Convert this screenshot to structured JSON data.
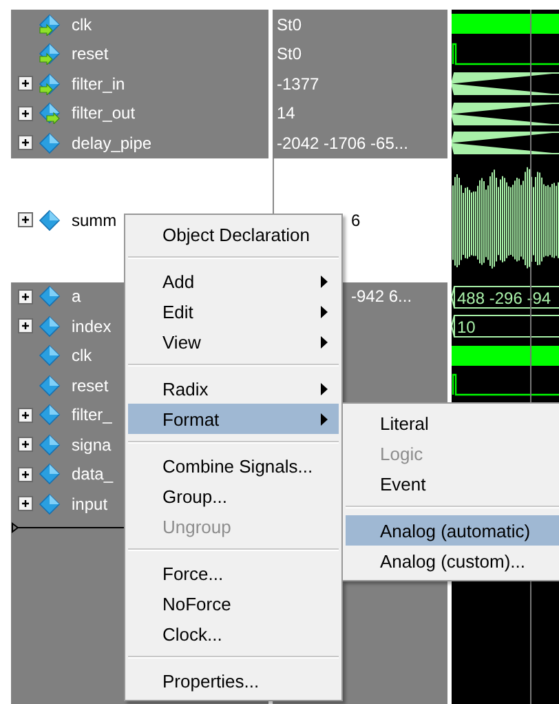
{
  "signals": [
    {
      "name": "clk",
      "value": "St0",
      "icon": {
        "kind": "in"
      },
      "selected": true,
      "wave": {
        "kind": "clock"
      }
    },
    {
      "name": "reset",
      "value": "St0",
      "icon": {
        "kind": "in"
      },
      "selected": true,
      "wave": {
        "kind": "bit"
      }
    },
    {
      "name": "filter_in",
      "value": "-1377",
      "icon": {
        "kind": "in"
      },
      "expanded": false,
      "selected": true,
      "wave": {
        "kind": "bus"
      }
    },
    {
      "name": "filter_out",
      "value": "14",
      "icon": {
        "kind": "out"
      },
      "expanded": false,
      "selected": true,
      "wave": {
        "kind": "bus"
      }
    },
    {
      "name": "delay_pipe",
      "value": "-2042 -1706 -65...",
      "icon": {
        "kind": "internal"
      },
      "expanded": false,
      "selected": true,
      "wave": {
        "kind": "bus"
      }
    },
    {
      "name": "summ",
      "value": "6",
      "icon": {
        "kind": "internal"
      },
      "expanded": false,
      "selected": false,
      "wave": {
        "kind": "analog"
      }
    },
    {
      "name": "a",
      "value": "-942 6...",
      "icon": {
        "kind": "internal"
      },
      "expanded": false,
      "selected": true,
      "wave": {
        "kind": "bus",
        "label": "488 -296 -94"
      }
    },
    {
      "name": "index",
      "icon": {
        "kind": "internal"
      },
      "expanded": false,
      "selected": true,
      "wave": {
        "kind": "bus",
        "label": "10"
      }
    },
    {
      "name": "clk",
      "icon": {
        "kind": "internal"
      },
      "selected": true,
      "wave": {
        "kind": "clock"
      }
    },
    {
      "name": "reset",
      "icon": {
        "kind": "internal"
      },
      "selected": true,
      "wave": {
        "kind": "bit"
      }
    },
    {
      "name": "filter_",
      "icon": {
        "kind": "internal"
      },
      "expanded": false,
      "selected": true
    },
    {
      "name": "signa",
      "icon": {
        "kind": "internal"
      },
      "expanded": false,
      "selected": true
    },
    {
      "name": "data_",
      "icon": {
        "kind": "internal"
      },
      "expanded": false,
      "selected": true
    },
    {
      "name": "input",
      "icon": {
        "kind": "internal"
      },
      "expanded": false,
      "selected": true
    }
  ],
  "context_menu": {
    "items": [
      {
        "kind": "item",
        "label": "Object Declaration",
        "has_submenu": false,
        "disabled": false,
        "selected": false
      },
      {
        "kind": "separator"
      },
      {
        "kind": "item",
        "label": "Add",
        "has_submenu": true,
        "disabled": false,
        "selected": false
      },
      {
        "kind": "item",
        "label": "Edit",
        "has_submenu": true,
        "disabled": false,
        "selected": false
      },
      {
        "kind": "item",
        "label": "View",
        "has_submenu": true,
        "disabled": false,
        "selected": false
      },
      {
        "kind": "separator"
      },
      {
        "kind": "item",
        "label": "Radix",
        "has_submenu": true,
        "disabled": false,
        "selected": false
      },
      {
        "kind": "item",
        "label": "Format",
        "has_submenu": true,
        "disabled": false,
        "selected": true
      },
      {
        "kind": "separator"
      },
      {
        "kind": "item",
        "label": "Combine Signals...",
        "has_submenu": false,
        "disabled": false,
        "selected": false
      },
      {
        "kind": "item",
        "label": "Group...",
        "has_submenu": false,
        "disabled": false,
        "selected": false
      },
      {
        "kind": "item",
        "label": "Ungroup",
        "has_submenu": false,
        "disabled": true,
        "selected": false
      },
      {
        "kind": "separator"
      },
      {
        "kind": "item",
        "label": "Force...",
        "has_submenu": false,
        "disabled": false,
        "selected": false
      },
      {
        "kind": "item",
        "label": "NoForce",
        "has_submenu": false,
        "disabled": false,
        "selected": false
      },
      {
        "kind": "item",
        "label": "Clock...",
        "has_submenu": false,
        "disabled": false,
        "selected": false
      },
      {
        "kind": "separator"
      },
      {
        "kind": "item",
        "label": "Properties...",
        "has_submenu": false,
        "disabled": false,
        "selected": false
      }
    ]
  },
  "format_submenu": {
    "items": [
      {
        "kind": "item",
        "label": "Literal",
        "disabled": false,
        "selected": false
      },
      {
        "kind": "item",
        "label": "Logic",
        "disabled": true,
        "selected": false
      },
      {
        "kind": "item",
        "label": "Event",
        "disabled": false,
        "selected": false
      },
      {
        "kind": "separator"
      },
      {
        "kind": "item",
        "label": "Analog (automatic)",
        "disabled": false,
        "selected": true
      },
      {
        "kind": "item",
        "label": "Analog (custom)...",
        "disabled": false,
        "selected": false
      }
    ]
  }
}
